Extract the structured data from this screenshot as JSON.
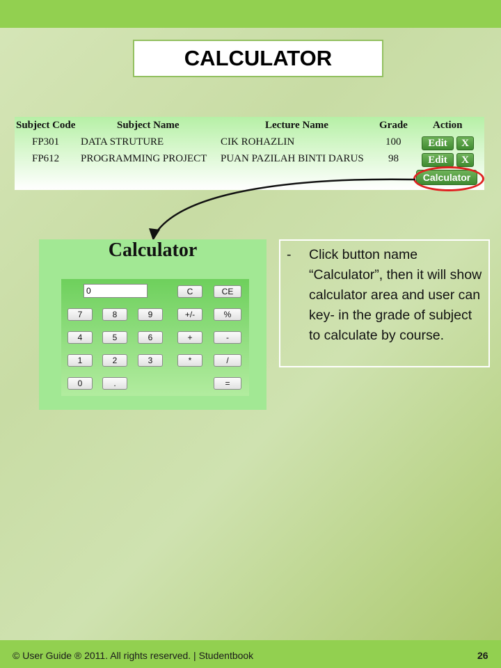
{
  "slide": {
    "title": "CALCULATOR",
    "footer": "© User Guide ® 2011. All rights reserved. | Studentbook",
    "page_number": "26"
  },
  "table": {
    "headers": [
      "Subject Code",
      "Subject Name",
      "Lecture Name",
      "Grade",
      "Action"
    ],
    "rows": [
      {
        "code": "FP301",
        "name": "DATA STRUTURE",
        "lecturer": "CIK ROHAZLIN",
        "grade": "100",
        "edit": "Edit",
        "delete": "X"
      },
      {
        "code": "FP612",
        "name": "PROGRAMMING PROJECT",
        "lecturer": "PUAN PAZILAH BINTI DARUS",
        "grade": "98",
        "edit": "Edit",
        "delete": "X"
      }
    ],
    "calculator_button": "Calculator"
  },
  "calculator": {
    "title": "Calculator",
    "display_value": "0",
    "keys": {
      "clear": "C",
      "clear_entry": "CE",
      "k7": "7",
      "k8": "8",
      "k9": "9",
      "plus_minus": "+/-",
      "percent": "%",
      "k4": "4",
      "k5": "5",
      "k6": "6",
      "add": "+",
      "subtract": "-",
      "k1": "1",
      "k2": "2",
      "k3": "3",
      "multiply": "*",
      "divide": "/",
      "k0": "0",
      "decimal": ".",
      "equals": "="
    }
  },
  "description": {
    "bullet": "-",
    "text": "Click button name “Calculator”, then it will show calculator area and user can key- in the grade of subject to calculate by course."
  },
  "colors": {
    "top_bar": "#92d050",
    "highlight_ellipse": "#e02020",
    "action_button": "#4a9a3a"
  }
}
